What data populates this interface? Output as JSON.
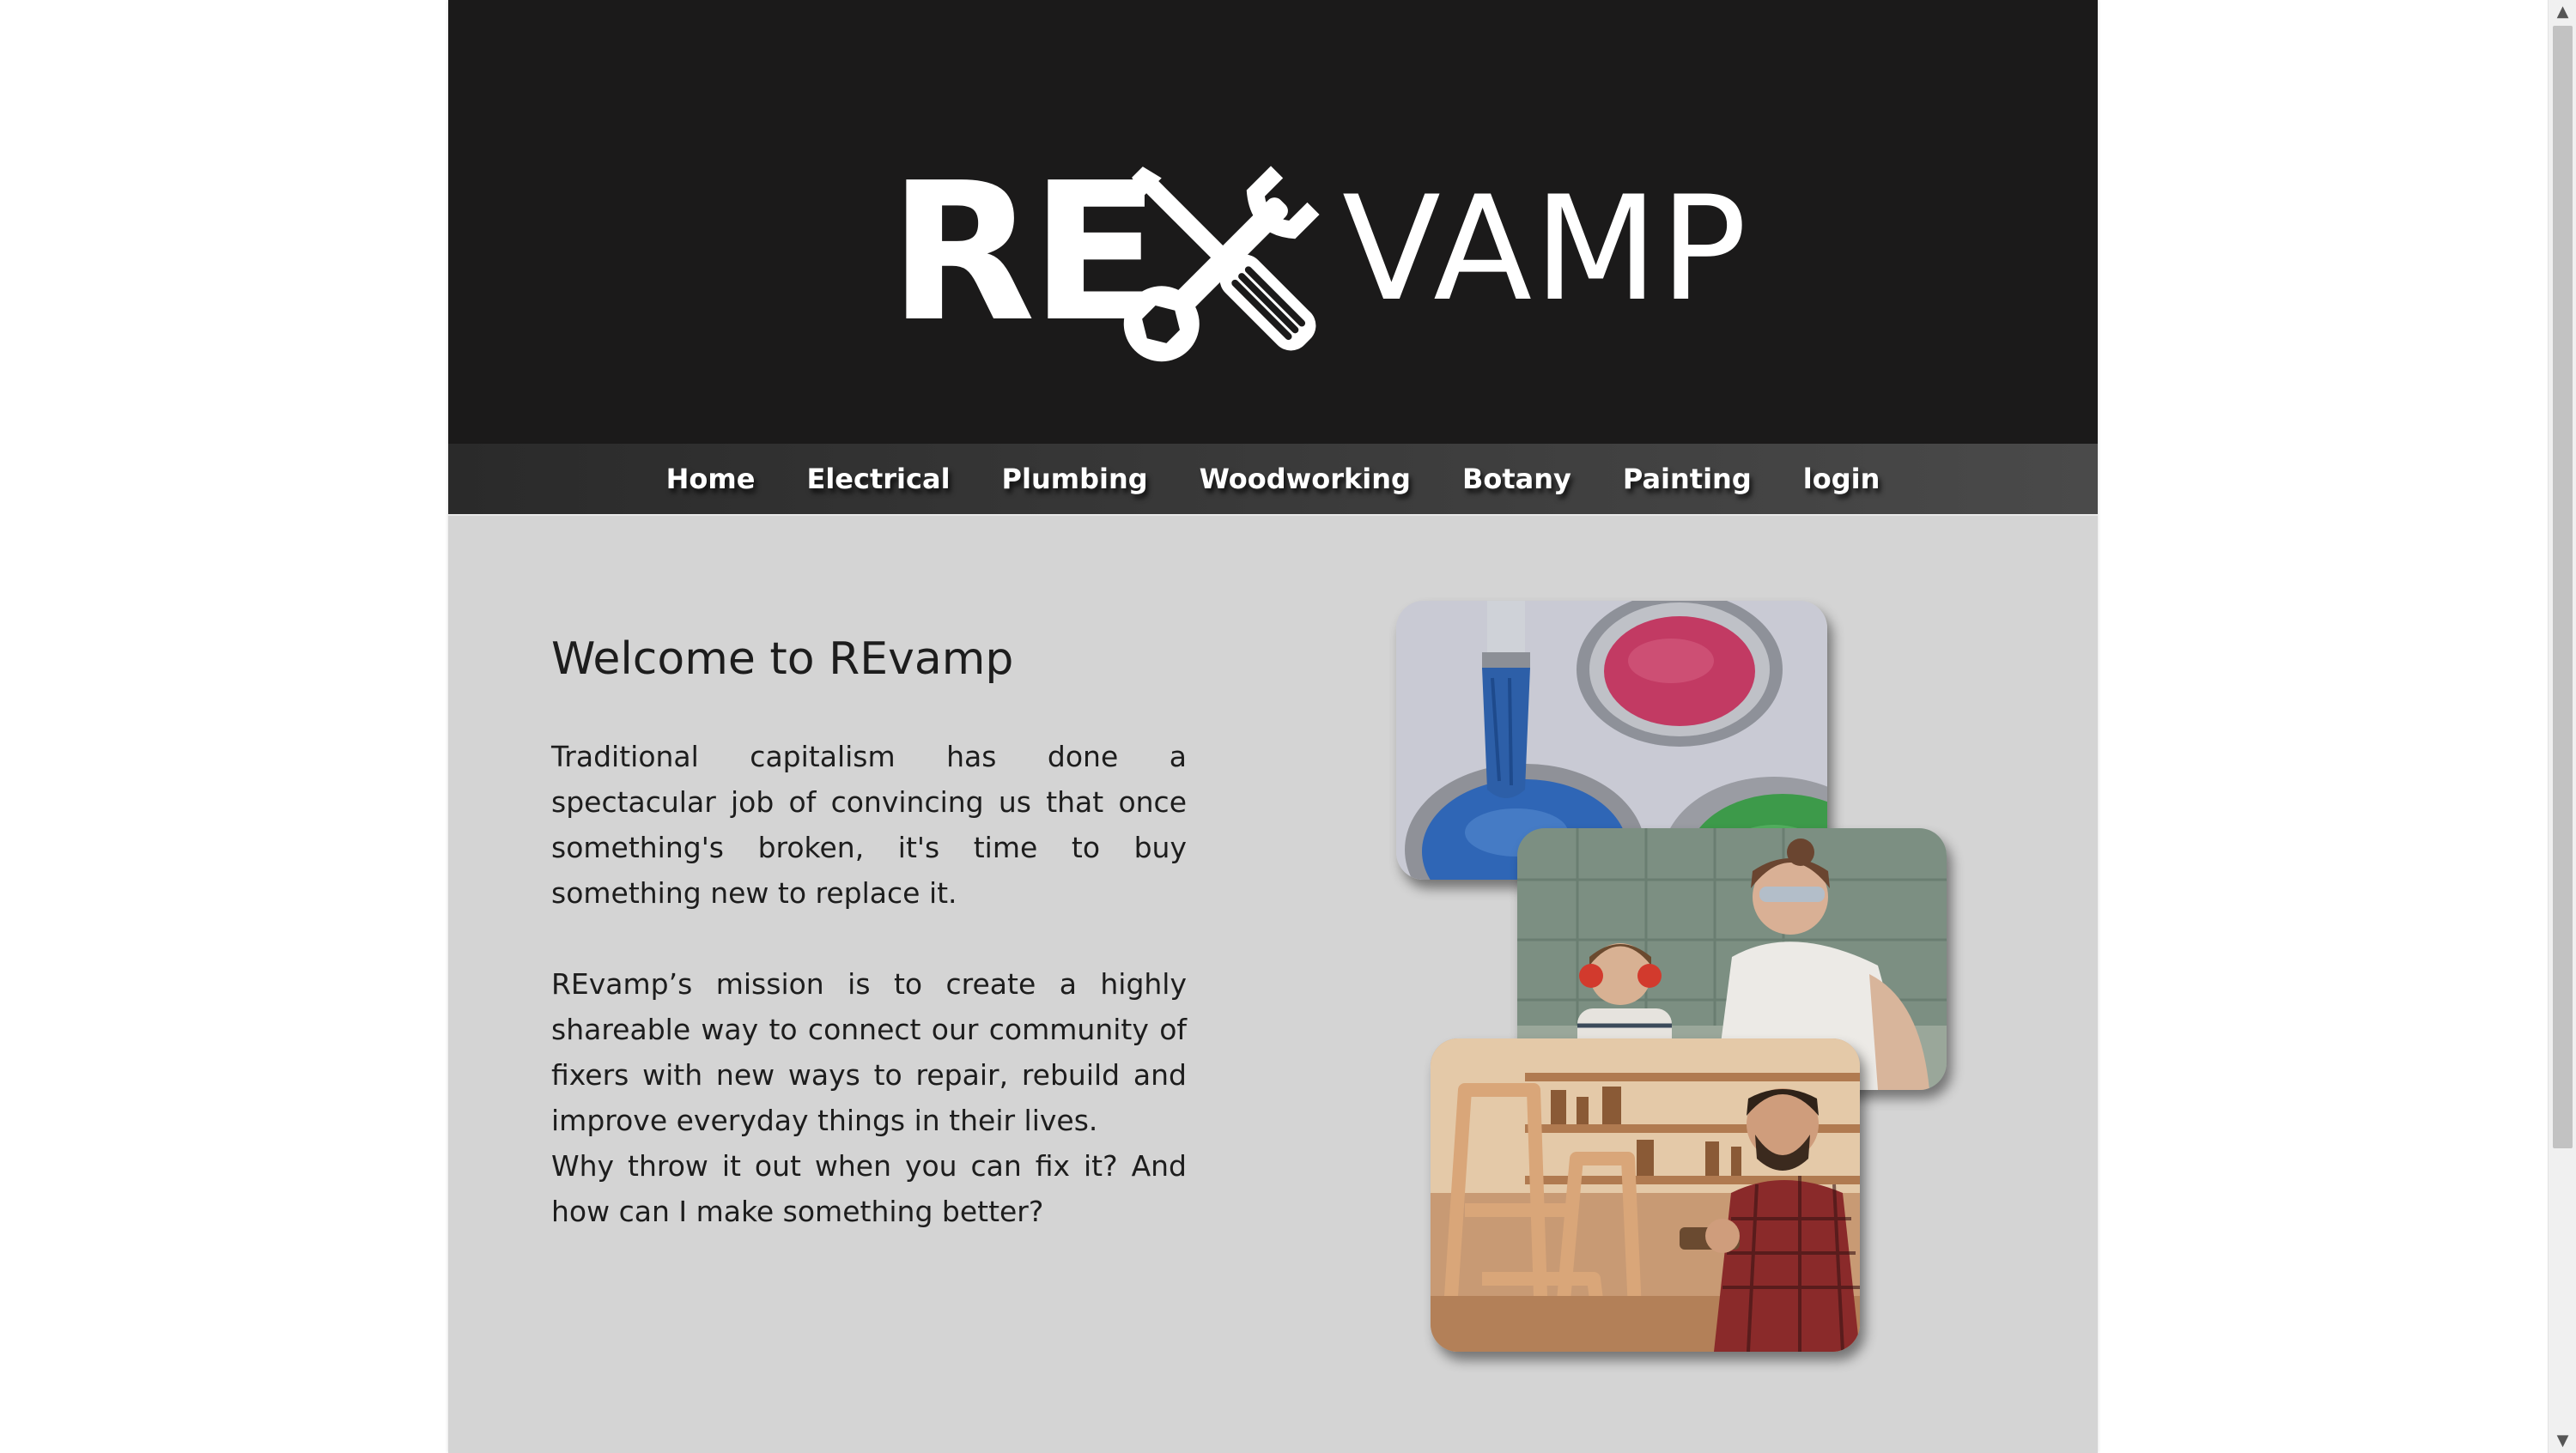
{
  "header": {
    "logo_part1": "RE",
    "logo_part2": "VAMP",
    "logo_icon": "wrench-screwdriver-icon",
    "background": "#1b1a1a"
  },
  "nav": {
    "items": [
      {
        "label": "Home"
      },
      {
        "label": "Electrical"
      },
      {
        "label": "Plumbing"
      },
      {
        "label": "Woodworking"
      },
      {
        "label": "Botany"
      },
      {
        "label": "Painting"
      },
      {
        "label": "login"
      }
    ]
  },
  "main": {
    "title": "Welcome to REvamp",
    "paragraph1": "Traditional capitalism has done a spectacular job of convincing us that once something's broken, it's time to buy something new to replace it.",
    "paragraph2": "REvamp’s mission is to create a highly shareable way to connect our community of fixers with new ways to repair, rebuild and improve everyday things in their lives.",
    "paragraph3": "Why throw it out when you can fix it? And how can I make something better?",
    "background": "#d4d4d4"
  },
  "photos": [
    {
      "subject": "paint-cans-with-brush"
    },
    {
      "subject": "woman-and-child-working-with-safety-goggles"
    },
    {
      "subject": "man-woodworking-in-workshop"
    }
  ],
  "scrollbar": {
    "up_icon": "chevron-up-icon",
    "down_icon": "chevron-down-icon"
  }
}
